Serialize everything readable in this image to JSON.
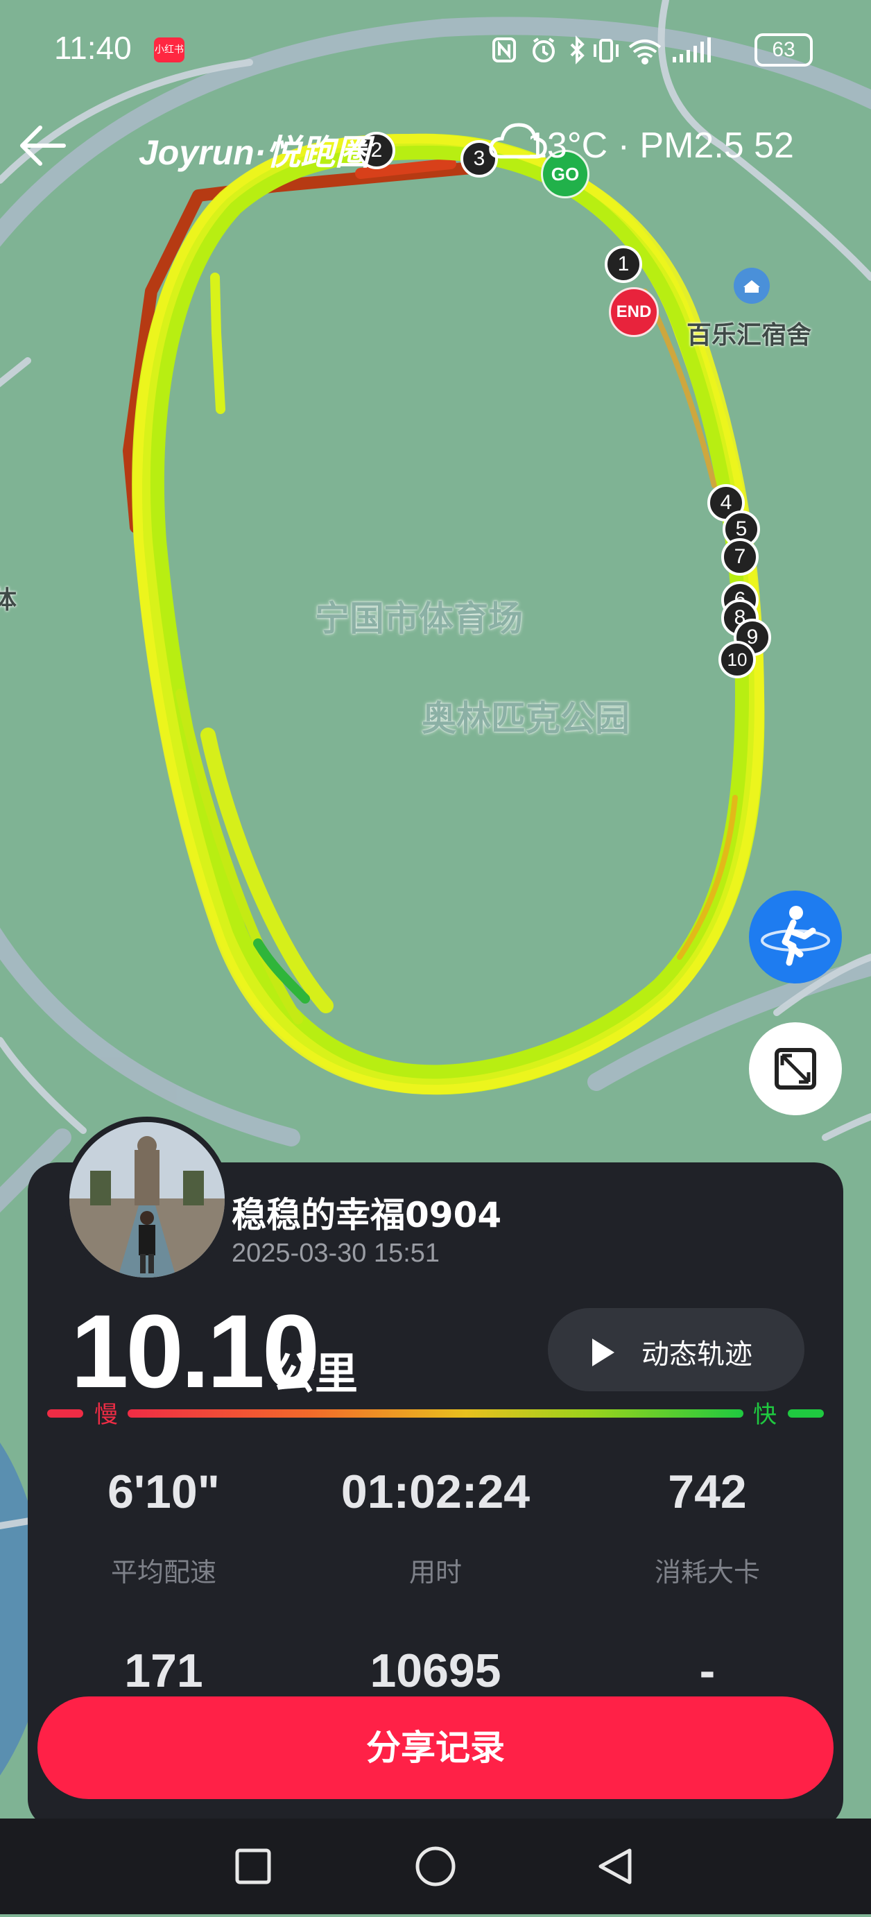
{
  "status_bar": {
    "time": "11:40",
    "app_badge": "小红书",
    "icons": [
      "nfc-icon",
      "alarm-icon",
      "bluetooth-icon",
      "vibrate-icon",
      "wifi-icon",
      "signal-icon"
    ],
    "battery": "63"
  },
  "header": {
    "brand": "Joyrun·悦跑圈",
    "weather": "13°C · PM2.5 52"
  },
  "map": {
    "labels": {
      "stadium": "宁国市体育场",
      "park": "奥林匹克公园",
      "poi": "百乐汇宿舍",
      "edge": "体"
    },
    "start_label": "GO",
    "end_label": "END",
    "km_markers": [
      "1",
      "2",
      "3",
      "4",
      "5",
      "6",
      "7",
      "8",
      "9",
      "10"
    ]
  },
  "record": {
    "username": "稳稳的幸福0904",
    "datetime": "2025-03-30 15:51",
    "distance": "10.10",
    "distance_unit": "公里",
    "replay_label": "动态轨迹",
    "pace_slow": "慢",
    "pace_fast": "快",
    "stats": [
      {
        "value": "6'10\"",
        "label": "平均配速"
      },
      {
        "value": "01:02:24",
        "label": "用时"
      },
      {
        "value": "742",
        "label": "消耗大卡"
      },
      {
        "value": "171",
        "label": ""
      },
      {
        "value": "10695",
        "label": ""
      },
      {
        "value": "-",
        "label": ""
      }
    ],
    "share_label": "分享记录"
  },
  "colors": {
    "map_green": "#7fb394",
    "route_yellow": "#d8f21a",
    "slow_red": "#ef2c45",
    "fast_green": "#1fc940",
    "share_red": "#ff2147",
    "card_bg": "#202228"
  }
}
